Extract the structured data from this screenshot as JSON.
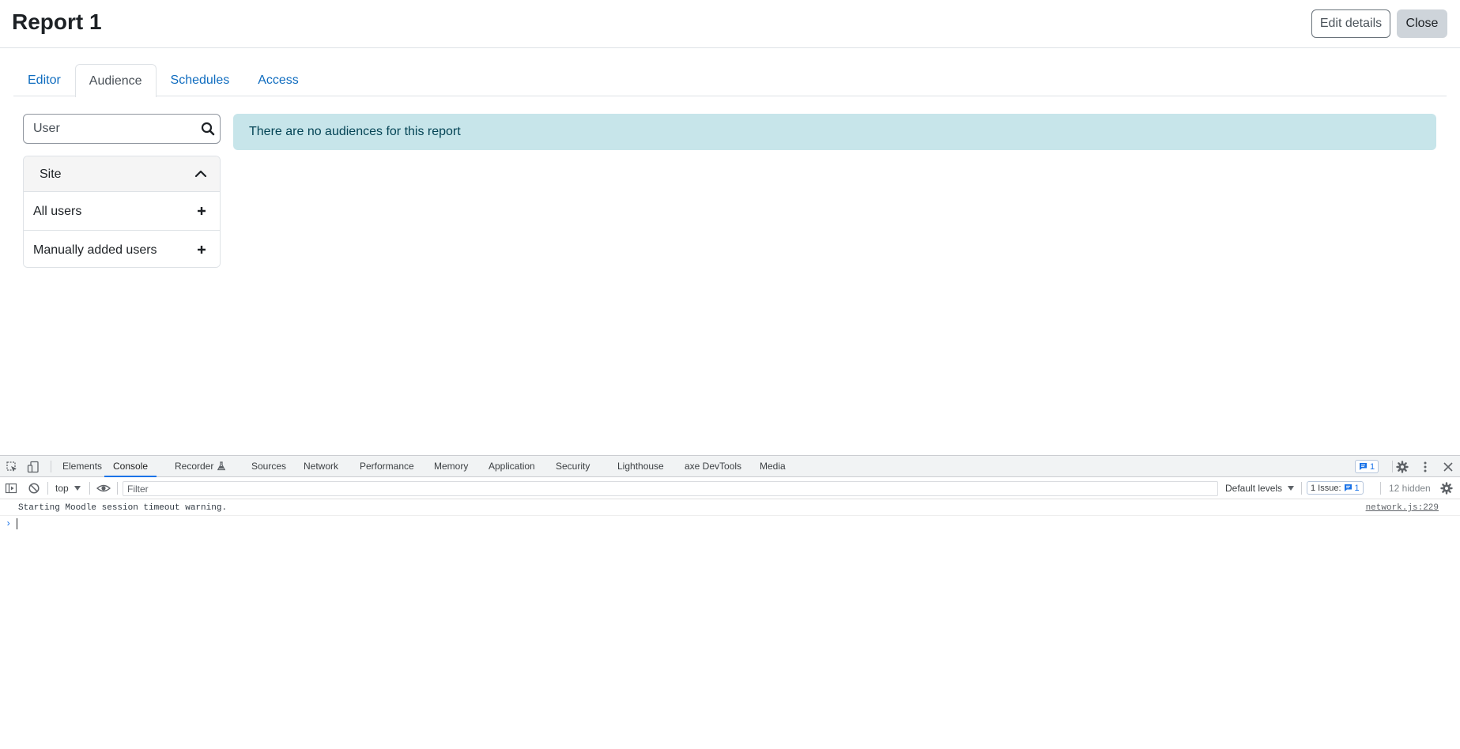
{
  "header": {
    "title": "Report 1",
    "edit_label": "Edit details",
    "close_label": "Close"
  },
  "tabs": [
    {
      "label": "Editor",
      "active": false
    },
    {
      "label": "Audience",
      "active": true
    },
    {
      "label": "Schedules",
      "active": false
    },
    {
      "label": "Access",
      "active": false
    }
  ],
  "search": {
    "placeholder": "User",
    "value": ""
  },
  "audience_panel": {
    "header": "Site",
    "items": [
      {
        "label": "All users"
      },
      {
        "label": "Manually added users"
      }
    ]
  },
  "alert": {
    "text": "There are no audiences for this report"
  },
  "devtools": {
    "tabs": [
      "Elements",
      "Console",
      "Recorder",
      "Sources",
      "Network",
      "Performance",
      "Memory",
      "Application",
      "Security",
      "Lighthouse",
      "axe DevTools",
      "Media"
    ],
    "active_tab": "Console",
    "issues_badge_count": "1",
    "context": "top",
    "filter_placeholder": "Filter",
    "levels_label": "Default levels",
    "issues_label": "1 Issue:",
    "issues_count": "1",
    "hidden_label": "12 hidden",
    "console": [
      {
        "message": "Starting Moodle session timeout warning.",
        "source": "network.js:229"
      }
    ]
  },
  "colors": {
    "link": "#0f6cbf",
    "alert_bg": "#c7e5ea",
    "alert_text": "#044455",
    "devtools_accent": "#1a73e8"
  }
}
